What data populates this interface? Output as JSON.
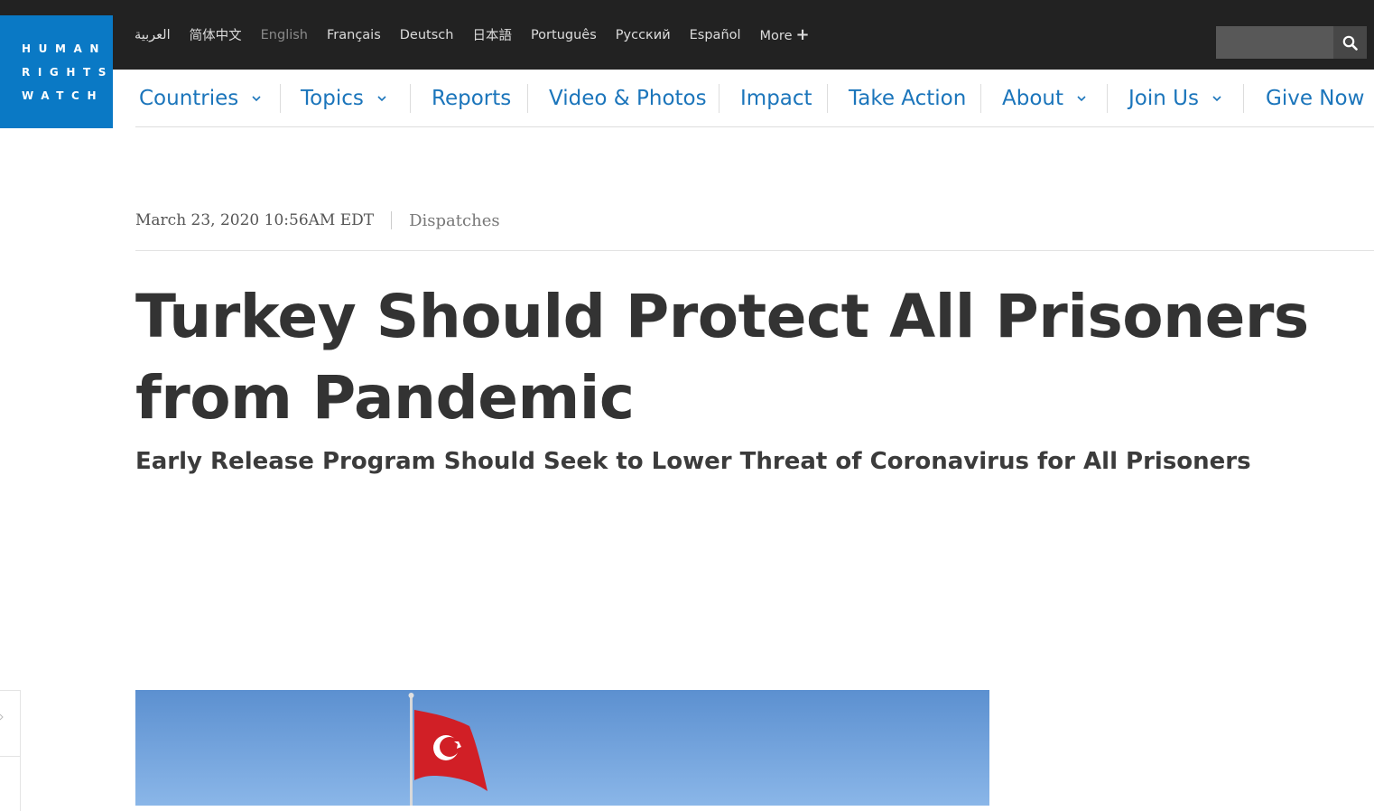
{
  "logo": {
    "lines": [
      "HUMAN",
      "RIGHTS",
      "WATCH"
    ]
  },
  "languages": [
    {
      "label": "العربية",
      "current": false
    },
    {
      "label": "简体中文",
      "current": false
    },
    {
      "label": "English",
      "current": true
    },
    {
      "label": "Français",
      "current": false
    },
    {
      "label": "Deutsch",
      "current": false
    },
    {
      "label": "日本語",
      "current": false
    },
    {
      "label": "Português",
      "current": false
    },
    {
      "label": "Русский",
      "current": false
    },
    {
      "label": "Español",
      "current": false
    }
  ],
  "more_label": "More",
  "search": {
    "placeholder": "",
    "icon": "search-icon"
  },
  "nav": [
    {
      "label": "Countries",
      "dropdown": true
    },
    {
      "label": "Topics",
      "dropdown": true
    },
    {
      "label": "Reports",
      "dropdown": false
    },
    {
      "label": "Video & Photos",
      "dropdown": false
    },
    {
      "label": "Impact",
      "dropdown": false
    },
    {
      "label": "Take Action",
      "dropdown": false
    },
    {
      "label": "About",
      "dropdown": true
    },
    {
      "label": "Join Us",
      "dropdown": true
    },
    {
      "label": "Give Now",
      "dropdown": true
    }
  ],
  "article": {
    "date": "March 23, 2020 10:56AM EDT",
    "category": "Dispatches",
    "title": "Turkey Should Protect All Prisoners from Pandemic",
    "subtitle": "Early Release Program Should Seek to Lower Threat of Coronavirus for All Prisoners"
  },
  "colors": {
    "brand_blue": "#0a79c5",
    "nav_link": "#1b75bb",
    "topbar": "#222222",
    "flag_red": "#d11f26"
  }
}
